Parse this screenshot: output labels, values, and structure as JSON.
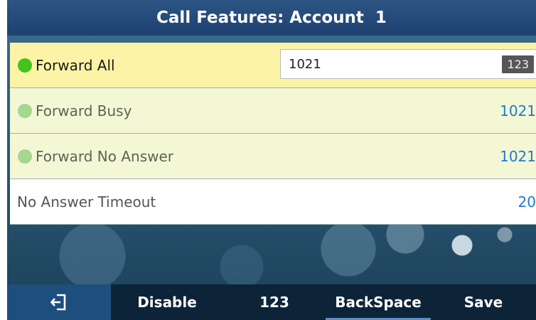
{
  "header": {
    "title": "Call Features: Account  1"
  },
  "rows": [
    {
      "label": "Forward All",
      "value": "1021",
      "ime_mode": "123",
      "status": "active"
    },
    {
      "label": "Forward Busy",
      "value": "1021",
      "status": "inactive"
    },
    {
      "label": "Forward No Answer",
      "value": "1021",
      "status": "inactive"
    },
    {
      "label": "No Answer Timeout",
      "value": "20"
    }
  ],
  "softkeys": {
    "back_icon": "exit-icon",
    "disable": "Disable",
    "mode": "123",
    "backspace": "BackSpace",
    "save": "Save"
  },
  "colors": {
    "title_bar": "#1e4170",
    "selected_row": "#fdf3a6",
    "forward_row": "#f3f7d4",
    "status_active": "#43c31b",
    "status_inactive": "#a3d88e",
    "value_text": "#1e7ad1",
    "softkey_bar": "#0d2338"
  }
}
